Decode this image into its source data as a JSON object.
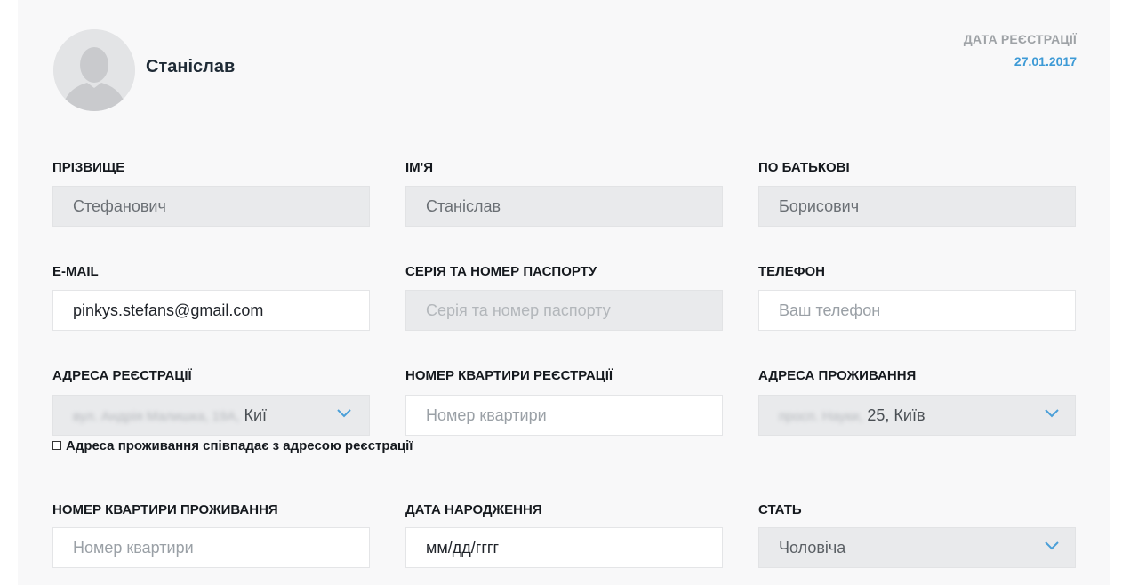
{
  "profile": {
    "name": "Станіслав",
    "registration_label": "ДАТА РЕЄСТРАЦІЇ",
    "registration_date": "27.01.2017",
    "avatar_icon": "user-silhouette-icon"
  },
  "fields": {
    "surname": {
      "label": "ПРІЗВИЩЕ",
      "value": "Стефанович"
    },
    "first_name": {
      "label": "ІМ'Я",
      "value": "Станіслав"
    },
    "patronymic": {
      "label": "ПО БАТЬКОВІ",
      "value": "Борисович"
    },
    "email": {
      "label": "E-MAIL",
      "value": "pinkys.stefans@gmail.com"
    },
    "passport": {
      "label": "СЕРІЯ ТА НОМЕР ПАСПОРТУ",
      "placeholder": "Серія та номер паспорту"
    },
    "phone": {
      "label": "ТЕЛЕФОН",
      "placeholder": "Ваш телефон"
    },
    "reg_address": {
      "label": "АДРЕСА РЕЄСТРАЦІЇ",
      "value_blurred": "вул. Андрія Малишка, 19А,",
      "value_visible": "Киї"
    },
    "reg_apartment": {
      "label": "НОМЕР КВАРТИРИ РЕЄСТРАЦІЇ",
      "placeholder": "Номер квартири"
    },
    "live_address": {
      "label": "АДРЕСА ПРОЖИВАННЯ",
      "value_blurred": "просп. Науки,",
      "value_visible": "25, Київ"
    },
    "same_address_checkbox": {
      "label": "Адреса проживання співпадає з адресою реєстрації",
      "checked": false
    },
    "live_apartment": {
      "label": "НОМЕР КВАРТИРИ ПРОЖИВАННЯ",
      "placeholder": "Номер квартири"
    },
    "birth_date": {
      "label": "ДАТА НАРОДЖЕННЯ",
      "value": "мм/дд/гггг"
    },
    "gender": {
      "label": "СТАТЬ",
      "value": "Чоловіча"
    }
  },
  "colors": {
    "accent": "#3d9ad6",
    "card_bg": "#f8f8f9",
    "disabled_field_bg": "#e9eaec"
  }
}
